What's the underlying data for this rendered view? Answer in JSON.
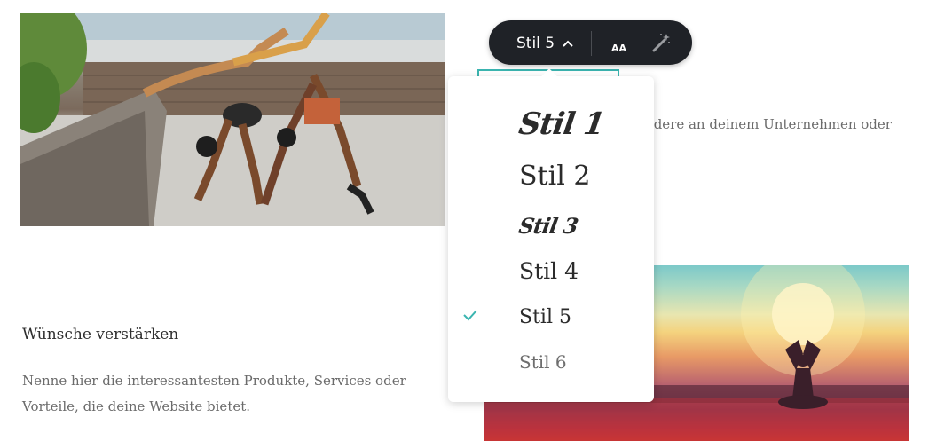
{
  "content": {
    "heading": "Wünsche verstärken",
    "body": "Nenne hier die interessantesten Produkte, Services oder Vorteile, die deine Website bietet.",
    "partial_text": "ondere an deinem Unternehmen oder"
  },
  "toolbar": {
    "style_label": "Stil 5",
    "font_size_label": "AA",
    "icons": {
      "style_chevron": "chevron-up-icon",
      "font_size": "font-size-icon",
      "magic": "magic-wand-icon"
    }
  },
  "style_menu": {
    "selected": "Stil 5",
    "items": [
      {
        "label": "Stil 1"
      },
      {
        "label": "Stil 2"
      },
      {
        "label": "Stil 3"
      },
      {
        "label": "Stil 4"
      },
      {
        "label": "Stil 5"
      },
      {
        "label": "Stil 6"
      }
    ]
  },
  "colors": {
    "toolbar_bg": "#1f2227",
    "accent_check": "#3bb5b0",
    "text_dark": "#2f2f2f",
    "text_muted": "#6b6b6b"
  }
}
